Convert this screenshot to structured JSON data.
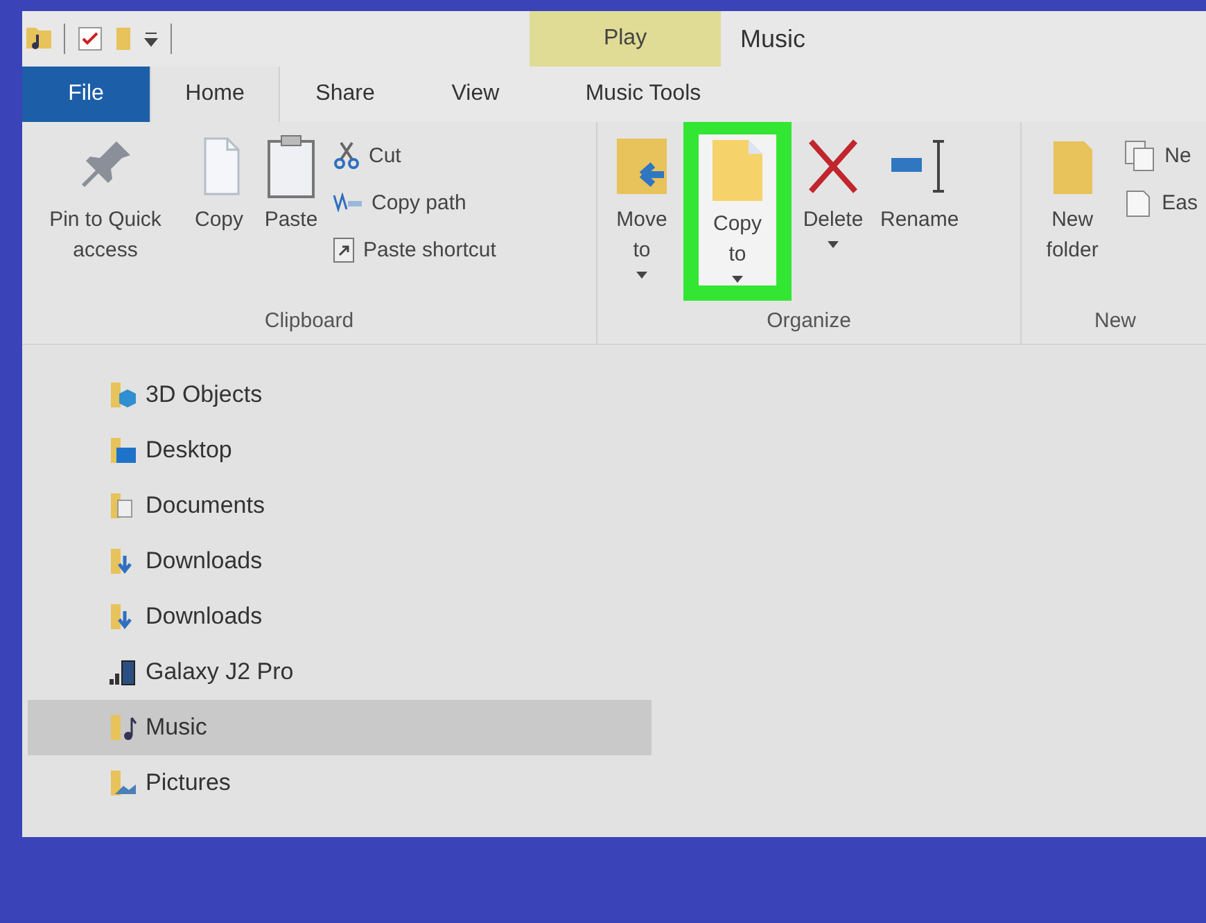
{
  "title_bar": {
    "contextual_group": "Play",
    "window_title": "Music"
  },
  "tabs": [
    {
      "label": "File",
      "kind": "file",
      "selected": false
    },
    {
      "label": "Home",
      "kind": "normal",
      "selected": true
    },
    {
      "label": "Share",
      "kind": "normal",
      "selected": false
    },
    {
      "label": "View",
      "kind": "normal",
      "selected": false
    },
    {
      "label": "Music Tools",
      "kind": "contextual",
      "selected": false
    }
  ],
  "ribbon": {
    "groups": [
      {
        "label": "Clipboard",
        "commands": [
          {
            "label": "Pin to Quick access",
            "kind": "large",
            "dropdown": false,
            "highlighted": false
          },
          {
            "label": "Copy",
            "kind": "large",
            "dropdown": false,
            "highlighted": false
          },
          {
            "label": "Paste",
            "kind": "large",
            "dropdown": false,
            "highlighted": false
          },
          {
            "label": "Cut",
            "kind": "small",
            "dropdown": false,
            "highlighted": false
          },
          {
            "label": "Copy path",
            "kind": "small",
            "dropdown": false,
            "highlighted": false
          },
          {
            "label": "Paste shortcut",
            "kind": "small",
            "dropdown": false,
            "highlighted": false
          }
        ]
      },
      {
        "label": "Organize",
        "commands": [
          {
            "label": "Move to",
            "kind": "large",
            "dropdown": true,
            "highlighted": false
          },
          {
            "label": "Copy to",
            "kind": "large",
            "dropdown": true,
            "highlighted": true
          },
          {
            "label": "Delete",
            "kind": "large",
            "dropdown": true,
            "highlighted": false
          },
          {
            "label": "Rename",
            "kind": "large",
            "dropdown": false,
            "highlighted": false
          }
        ]
      },
      {
        "label": "New",
        "commands": [
          {
            "label": "New folder",
            "kind": "large",
            "dropdown": false,
            "highlighted": false
          },
          {
            "label": "Ne",
            "kind": "small",
            "dropdown": false,
            "highlighted": false
          },
          {
            "label": "Eas",
            "kind": "small",
            "dropdown": false,
            "highlighted": false
          }
        ]
      }
    ]
  },
  "navigation_tree": {
    "items": [
      {
        "label": "3D Objects",
        "selected": false
      },
      {
        "label": "Desktop",
        "selected": false
      },
      {
        "label": "Documents",
        "selected": false
      },
      {
        "label": "Downloads",
        "selected": false
      },
      {
        "label": "Downloads",
        "selected": false
      },
      {
        "label": "Galaxy J2 Pro",
        "selected": false
      },
      {
        "label": "Music",
        "selected": true
      },
      {
        "label": "Pictures",
        "selected": false
      }
    ]
  }
}
